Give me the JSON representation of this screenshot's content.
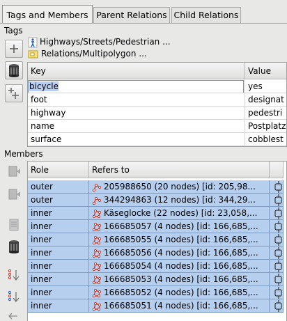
{
  "tabs": [
    {
      "label": "Tags and Members",
      "active": true
    },
    {
      "label": "Parent Relations",
      "active": false
    },
    {
      "label": "Child Relations",
      "active": false
    }
  ],
  "tags_section_label": "Tags",
  "presets": [
    {
      "icon": "pedestrian-icon",
      "label": "Highways/Streets/Pedestrian ..."
    },
    {
      "icon": "multipolygon-icon",
      "label": "Relations/Multipolygon ..."
    }
  ],
  "tag_table": {
    "columns": [
      "Key",
      "Value"
    ],
    "editing_key": "bicycle",
    "rows": [
      {
        "key": "bicycle",
        "value": "yes"
      },
      {
        "key": "foot",
        "value": "designat"
      },
      {
        "key": "highway",
        "value": "pedestri"
      },
      {
        "key": "name",
        "value": "Postplatz"
      },
      {
        "key": "surface",
        "value": "cobblest"
      }
    ]
  },
  "members_section_label": "Members",
  "member_table": {
    "columns": [
      "Role",
      "Refers to"
    ],
    "rows": [
      {
        "role": "outer",
        "refers": "205988650 (20 nodes) [id: 205,98...",
        "kind": "way"
      },
      {
        "role": "outer",
        "refers": "344294863 (12 nodes) [id: 344,29...",
        "kind": "way"
      },
      {
        "role": "inner",
        "refers": "Käseglocke (22 nodes) [id: 23,058,...",
        "kind": "closed-way"
      },
      {
        "role": "inner",
        "refers": "166685057 (4 nodes) [id: 166,685,...",
        "kind": "closed-way"
      },
      {
        "role": "inner",
        "refers": "166685055 (4 nodes) [id: 166,685,...",
        "kind": "closed-way"
      },
      {
        "role": "inner",
        "refers": "166685056 (4 nodes) [id: 166,685,...",
        "kind": "closed-way"
      },
      {
        "role": "inner",
        "refers": "166685054 (4 nodes) [id: 166,685,...",
        "kind": "closed-way"
      },
      {
        "role": "inner",
        "refers": "166685053 (4 nodes) [id: 166,685,...",
        "kind": "closed-way"
      },
      {
        "role": "inner",
        "refers": "166685052 (4 nodes) [id: 166,685,...",
        "kind": "closed-way"
      },
      {
        "role": "inner",
        "refers": "166685051 (4 nodes) [id: 166,685,...",
        "kind": "closed-way"
      }
    ]
  },
  "colors": {
    "selection": "#b7cfef",
    "accent": "#c0392b",
    "preset_blue": "#1f5fc8"
  }
}
